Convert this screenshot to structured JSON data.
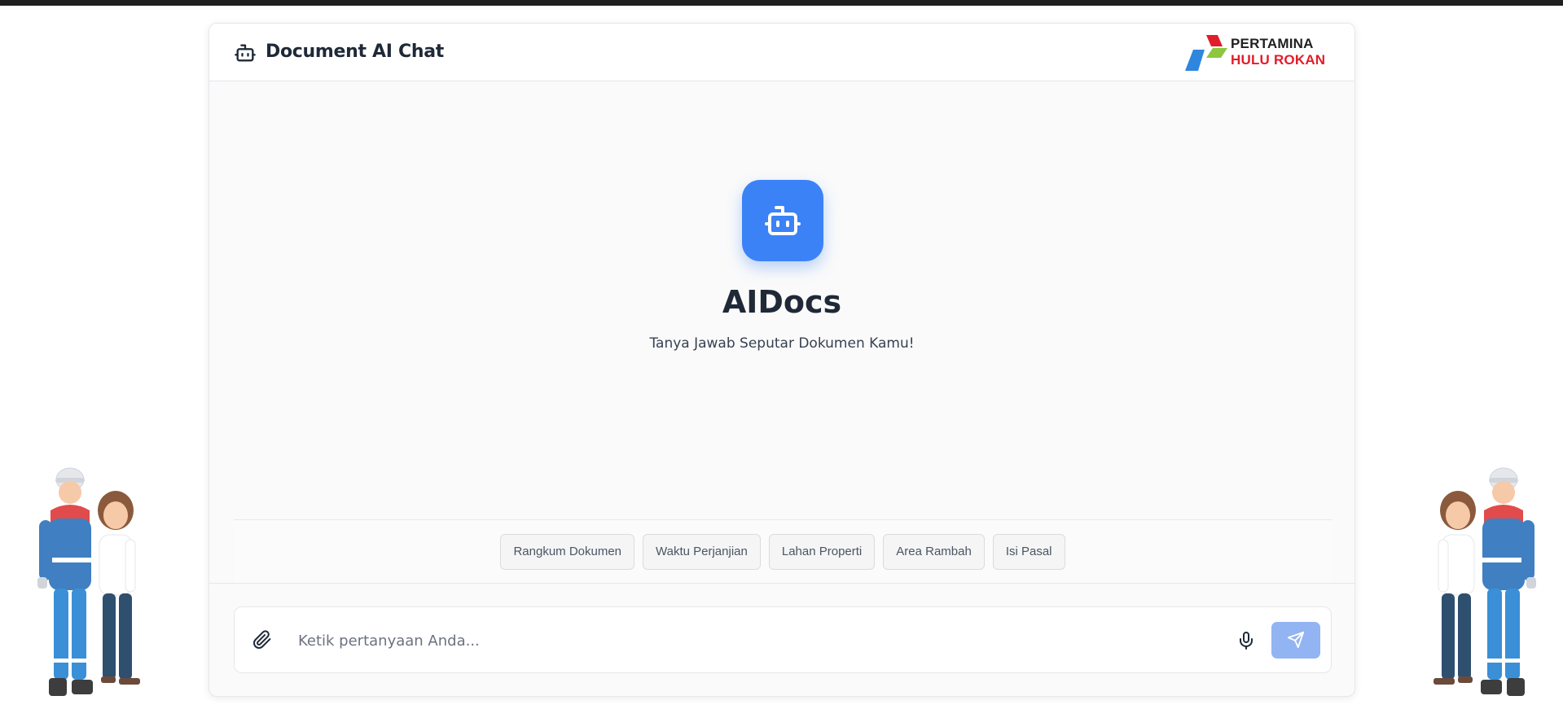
{
  "header": {
    "title": "Document AI Chat",
    "icon": "bot-icon",
    "logo": {
      "line1": "PERTAMINA",
      "line2": "HULU ROKAN"
    }
  },
  "hero": {
    "icon": "bot-icon",
    "title": "AIDocs",
    "subtitle": "Tanya Jawab Seputar Dokumen Kamu!"
  },
  "suggestions": [
    {
      "label": "Rangkum Dokumen"
    },
    {
      "label": "Waktu Perjanjian"
    },
    {
      "label": "Lahan Properti"
    },
    {
      "label": "Area Rambah"
    },
    {
      "label": "Isi Pasal"
    }
  ],
  "composer": {
    "placeholder": "Ketik pertanyaan Anda...",
    "value": "",
    "attach_icon": "paperclip-icon",
    "mic_icon": "microphone-icon",
    "send_icon": "send-icon"
  },
  "colors": {
    "accent": "#3b82f6",
    "send_disabled": "#93b4f2",
    "logo_red": "#e11d2a",
    "logo_green": "#8dc63f",
    "logo_blue": "#2e86de"
  }
}
